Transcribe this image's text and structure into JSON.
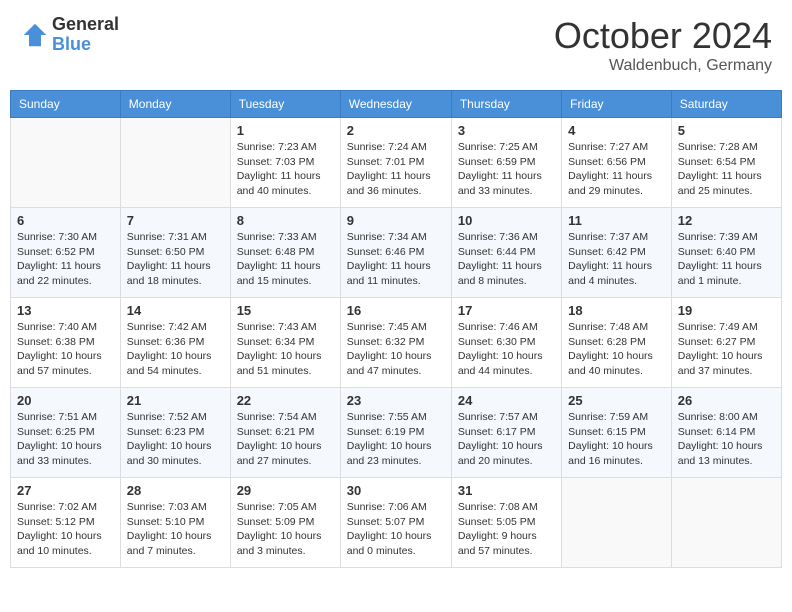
{
  "header": {
    "logo_general": "General",
    "logo_blue": "Blue",
    "month": "October 2024",
    "location": "Waldenbuch, Germany"
  },
  "days_of_week": [
    "Sunday",
    "Monday",
    "Tuesday",
    "Wednesday",
    "Thursday",
    "Friday",
    "Saturday"
  ],
  "weeks": [
    [
      {
        "day": "",
        "sunrise": "",
        "sunset": "",
        "daylight": ""
      },
      {
        "day": "",
        "sunrise": "",
        "sunset": "",
        "daylight": ""
      },
      {
        "day": "1",
        "sunrise": "Sunrise: 7:23 AM",
        "sunset": "Sunset: 7:03 PM",
        "daylight": "Daylight: 11 hours and 40 minutes."
      },
      {
        "day": "2",
        "sunrise": "Sunrise: 7:24 AM",
        "sunset": "Sunset: 7:01 PM",
        "daylight": "Daylight: 11 hours and 36 minutes."
      },
      {
        "day": "3",
        "sunrise": "Sunrise: 7:25 AM",
        "sunset": "Sunset: 6:59 PM",
        "daylight": "Daylight: 11 hours and 33 minutes."
      },
      {
        "day": "4",
        "sunrise": "Sunrise: 7:27 AM",
        "sunset": "Sunset: 6:56 PM",
        "daylight": "Daylight: 11 hours and 29 minutes."
      },
      {
        "day": "5",
        "sunrise": "Sunrise: 7:28 AM",
        "sunset": "Sunset: 6:54 PM",
        "daylight": "Daylight: 11 hours and 25 minutes."
      }
    ],
    [
      {
        "day": "6",
        "sunrise": "Sunrise: 7:30 AM",
        "sunset": "Sunset: 6:52 PM",
        "daylight": "Daylight: 11 hours and 22 minutes."
      },
      {
        "day": "7",
        "sunrise": "Sunrise: 7:31 AM",
        "sunset": "Sunset: 6:50 PM",
        "daylight": "Daylight: 11 hours and 18 minutes."
      },
      {
        "day": "8",
        "sunrise": "Sunrise: 7:33 AM",
        "sunset": "Sunset: 6:48 PM",
        "daylight": "Daylight: 11 hours and 15 minutes."
      },
      {
        "day": "9",
        "sunrise": "Sunrise: 7:34 AM",
        "sunset": "Sunset: 6:46 PM",
        "daylight": "Daylight: 11 hours and 11 minutes."
      },
      {
        "day": "10",
        "sunrise": "Sunrise: 7:36 AM",
        "sunset": "Sunset: 6:44 PM",
        "daylight": "Daylight: 11 hours and 8 minutes."
      },
      {
        "day": "11",
        "sunrise": "Sunrise: 7:37 AM",
        "sunset": "Sunset: 6:42 PM",
        "daylight": "Daylight: 11 hours and 4 minutes."
      },
      {
        "day": "12",
        "sunrise": "Sunrise: 7:39 AM",
        "sunset": "Sunset: 6:40 PM",
        "daylight": "Daylight: 11 hours and 1 minute."
      }
    ],
    [
      {
        "day": "13",
        "sunrise": "Sunrise: 7:40 AM",
        "sunset": "Sunset: 6:38 PM",
        "daylight": "Daylight: 10 hours and 57 minutes."
      },
      {
        "day": "14",
        "sunrise": "Sunrise: 7:42 AM",
        "sunset": "Sunset: 6:36 PM",
        "daylight": "Daylight: 10 hours and 54 minutes."
      },
      {
        "day": "15",
        "sunrise": "Sunrise: 7:43 AM",
        "sunset": "Sunset: 6:34 PM",
        "daylight": "Daylight: 10 hours and 51 minutes."
      },
      {
        "day": "16",
        "sunrise": "Sunrise: 7:45 AM",
        "sunset": "Sunset: 6:32 PM",
        "daylight": "Daylight: 10 hours and 47 minutes."
      },
      {
        "day": "17",
        "sunrise": "Sunrise: 7:46 AM",
        "sunset": "Sunset: 6:30 PM",
        "daylight": "Daylight: 10 hours and 44 minutes."
      },
      {
        "day": "18",
        "sunrise": "Sunrise: 7:48 AM",
        "sunset": "Sunset: 6:28 PM",
        "daylight": "Daylight: 10 hours and 40 minutes."
      },
      {
        "day": "19",
        "sunrise": "Sunrise: 7:49 AM",
        "sunset": "Sunset: 6:27 PM",
        "daylight": "Daylight: 10 hours and 37 minutes."
      }
    ],
    [
      {
        "day": "20",
        "sunrise": "Sunrise: 7:51 AM",
        "sunset": "Sunset: 6:25 PM",
        "daylight": "Daylight: 10 hours and 33 minutes."
      },
      {
        "day": "21",
        "sunrise": "Sunrise: 7:52 AM",
        "sunset": "Sunset: 6:23 PM",
        "daylight": "Daylight: 10 hours and 30 minutes."
      },
      {
        "day": "22",
        "sunrise": "Sunrise: 7:54 AM",
        "sunset": "Sunset: 6:21 PM",
        "daylight": "Daylight: 10 hours and 27 minutes."
      },
      {
        "day": "23",
        "sunrise": "Sunrise: 7:55 AM",
        "sunset": "Sunset: 6:19 PM",
        "daylight": "Daylight: 10 hours and 23 minutes."
      },
      {
        "day": "24",
        "sunrise": "Sunrise: 7:57 AM",
        "sunset": "Sunset: 6:17 PM",
        "daylight": "Daylight: 10 hours and 20 minutes."
      },
      {
        "day": "25",
        "sunrise": "Sunrise: 7:59 AM",
        "sunset": "Sunset: 6:15 PM",
        "daylight": "Daylight: 10 hours and 16 minutes."
      },
      {
        "day": "26",
        "sunrise": "Sunrise: 8:00 AM",
        "sunset": "Sunset: 6:14 PM",
        "daylight": "Daylight: 10 hours and 13 minutes."
      }
    ],
    [
      {
        "day": "27",
        "sunrise": "Sunrise: 7:02 AM",
        "sunset": "Sunset: 5:12 PM",
        "daylight": "Daylight: 10 hours and 10 minutes."
      },
      {
        "day": "28",
        "sunrise": "Sunrise: 7:03 AM",
        "sunset": "Sunset: 5:10 PM",
        "daylight": "Daylight: 10 hours and 7 minutes."
      },
      {
        "day": "29",
        "sunrise": "Sunrise: 7:05 AM",
        "sunset": "Sunset: 5:09 PM",
        "daylight": "Daylight: 10 hours and 3 minutes."
      },
      {
        "day": "30",
        "sunrise": "Sunrise: 7:06 AM",
        "sunset": "Sunset: 5:07 PM",
        "daylight": "Daylight: 10 hours and 0 minutes."
      },
      {
        "day": "31",
        "sunrise": "Sunrise: 7:08 AM",
        "sunset": "Sunset: 5:05 PM",
        "daylight": "Daylight: 9 hours and 57 minutes."
      },
      {
        "day": "",
        "sunrise": "",
        "sunset": "",
        "daylight": ""
      },
      {
        "day": "",
        "sunrise": "",
        "sunset": "",
        "daylight": ""
      }
    ]
  ]
}
